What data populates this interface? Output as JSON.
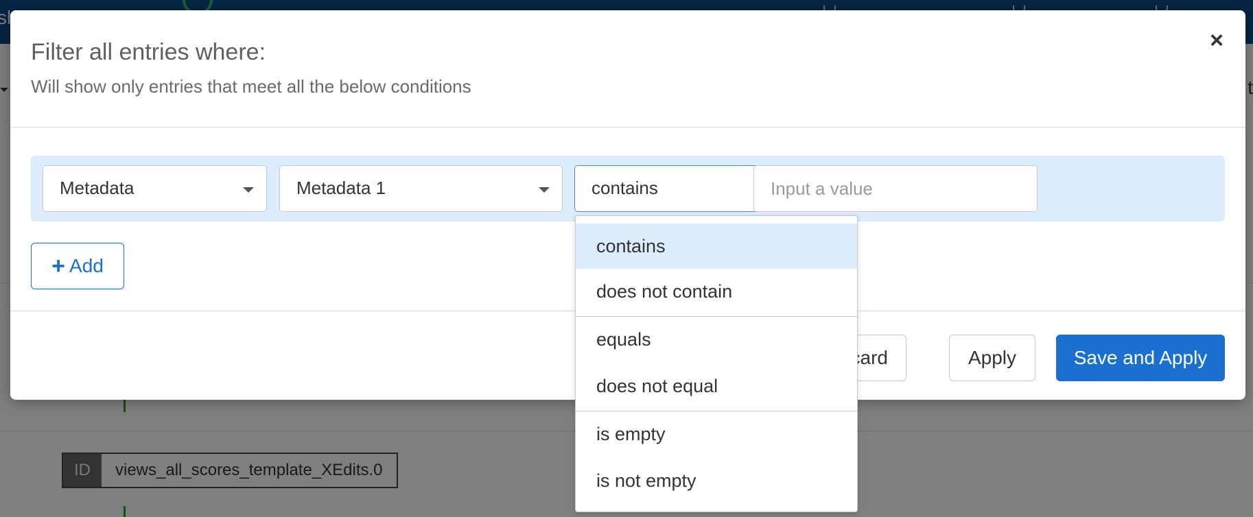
{
  "background": {
    "logo_fragment": "sl",
    "right_fragment": "t",
    "id_tag": "ID",
    "id_value": "views_all_scores_template_XEdits.0"
  },
  "modal": {
    "title": "Filter all entries where:",
    "subtitle": "Will show only entries that meet all the below conditions",
    "close_glyph": "×",
    "filter": {
      "field_select": "Metadata",
      "key_select": "Metadata 1",
      "operator_select": "contains",
      "value_placeholder": "Input a value",
      "value": ""
    },
    "add_label": "Add",
    "add_glyph": "+",
    "discard_label": "card",
    "apply_label": "Apply",
    "save_apply_label": "Save and Apply"
  },
  "operator_dropdown": {
    "options": [
      "contains",
      "does not contain",
      "equals",
      "does not equal",
      "is empty",
      "is not empty"
    ],
    "selected": "contains"
  },
  "colors": {
    "primary": "#1a6fcf",
    "topbar": "#0d4a8a",
    "row_highlight": "#dcecfc"
  }
}
